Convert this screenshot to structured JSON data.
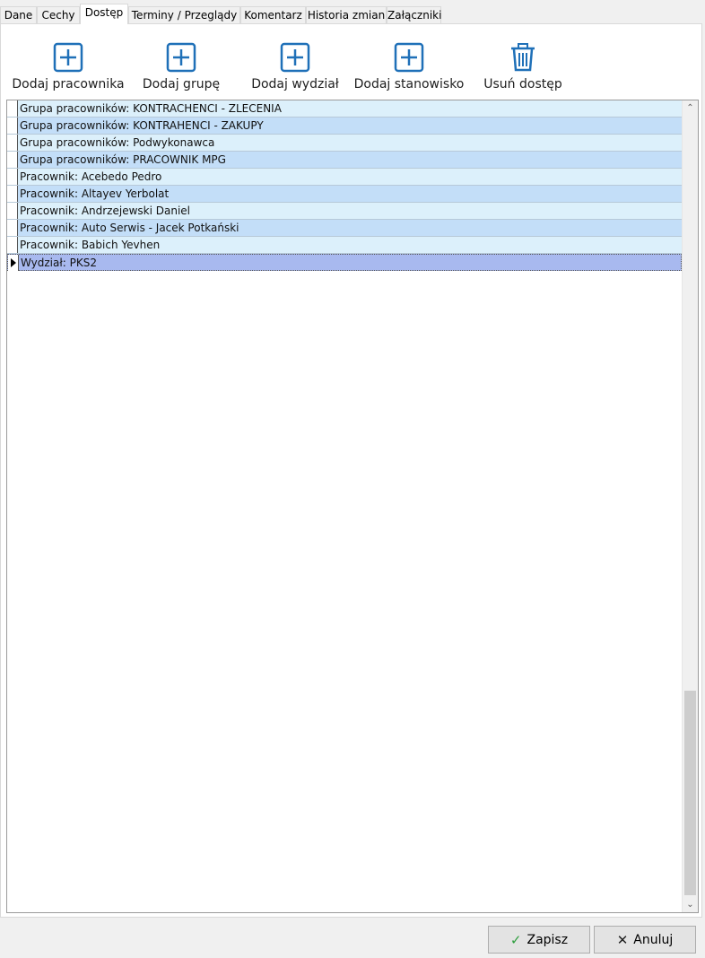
{
  "tabs": [
    {
      "label": "Dane"
    },
    {
      "label": "Cechy"
    },
    {
      "label": "Dostęp"
    },
    {
      "label": "Terminy / Przeglądy"
    },
    {
      "label": "Komentarz"
    },
    {
      "label": "Historia zmian"
    },
    {
      "label": "Załączniki"
    }
  ],
  "active_tab": "Dostęp",
  "toolbar": {
    "add_employee": "Dodaj pracownika",
    "add_group": "Dodaj grupę",
    "add_department": "Dodaj wydział",
    "add_position": "Dodaj stanowisko",
    "remove_access": "Usuń dostęp"
  },
  "access_list": [
    {
      "text": "Grupa pracowników: KONTRACHENCI - ZLECENIA"
    },
    {
      "text": "Grupa pracowników: KONTRAHENCI - ZAKUPY"
    },
    {
      "text": "Grupa pracowników: Podwykonawca"
    },
    {
      "text": "Grupa pracowników: PRACOWNIK MPG"
    },
    {
      "text": "Pracownik: Acebedo Pedro"
    },
    {
      "text": "Pracownik: Altayev Yerbolat"
    },
    {
      "text": "Pracownik: Andrzejewski Daniel"
    },
    {
      "text": "Pracownik: Auto Serwis - Jacek Potkański"
    },
    {
      "text": "Pracownik: Babich Yevhen"
    },
    {
      "text": "Wydział: PKS2"
    }
  ],
  "selected_row": "Wydział: PKS2",
  "buttons": {
    "save": "Zapisz",
    "cancel": "Anuluj"
  },
  "colors": {
    "icon_blue": "#1f70b8",
    "row_light": "#dcf0fb",
    "row_dark": "#c3def8",
    "row_selected": "#a8b9ef",
    "save_check": "#2e9e3e"
  }
}
